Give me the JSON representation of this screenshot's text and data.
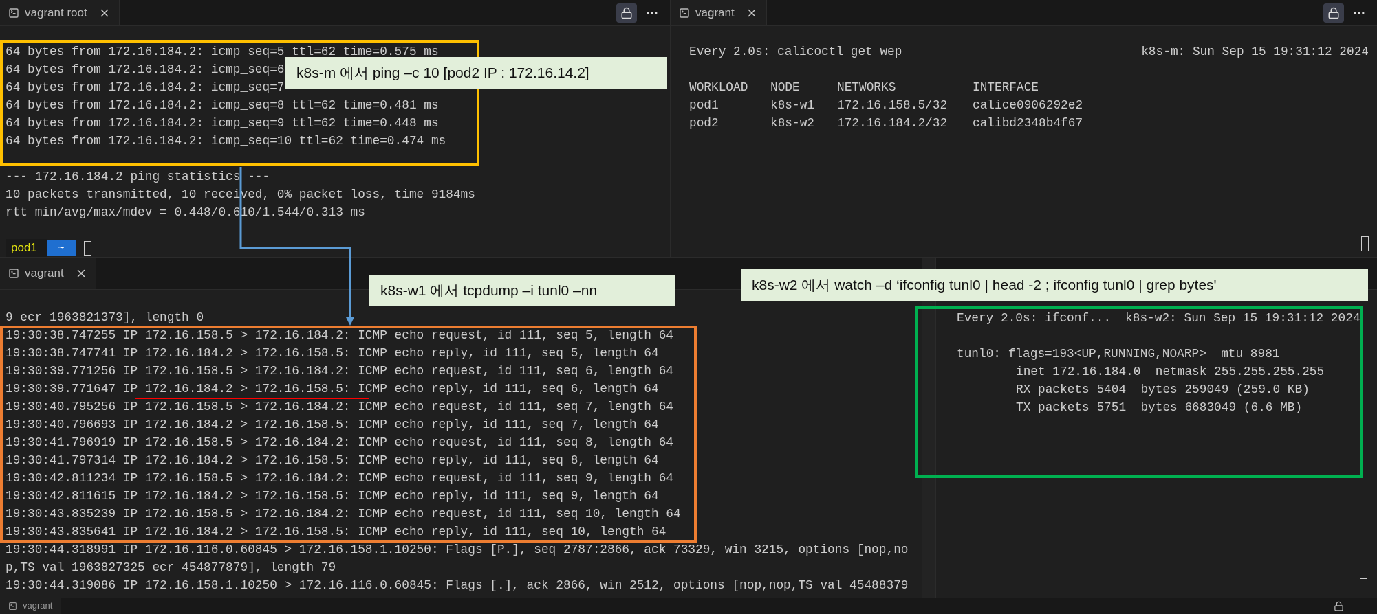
{
  "top_left_terminal": {
    "tab": {
      "label": "vagrant root"
    },
    "ping_replies": [
      "64 bytes from 172.16.184.2: icmp_seq=5 ttl=62 time=0.575 ms",
      "64 bytes from 172.16.184.2: icmp_seq=6",
      "64 bytes from 172.16.184.2: icmp_seq=7",
      "64 bytes from 172.16.184.2: icmp_seq=8 ttl=62 time=0.481 ms",
      "64 bytes from 172.16.184.2: icmp_seq=9 ttl=62 time=0.448 ms",
      "64 bytes from 172.16.184.2: icmp_seq=10 ttl=62 time=0.474 ms"
    ],
    "statistics": [
      "--- 172.16.184.2 ping statistics ---",
      "10 packets transmitted, 10 received, 0% packet loss, time 9184ms",
      "rtt min/avg/max/mdev = 0.448/0.610/1.544/0.313 ms"
    ],
    "prompt": {
      "user": "pod1",
      "path": "~"
    }
  },
  "top_right_terminal": {
    "tab": {
      "label": "vagrant"
    },
    "header": {
      "command": "Every 2.0s: calicoctl get wep",
      "status": "k8s-m: Sun Sep 15 19:31:12 2024"
    },
    "table": {
      "columns": [
        "WORKLOAD",
        "NODE",
        "NETWORKS",
        "INTERFACE"
      ],
      "rows": [
        [
          "pod1",
          "k8s-w1",
          "172.16.158.5/32",
          "calice0906292e2"
        ],
        [
          "pod2",
          "k8s-w2",
          "172.16.184.2/32",
          "calibd2348b4f67"
        ]
      ]
    }
  },
  "bottom_left_terminal": {
    "tab": {
      "label": "vagrant"
    },
    "lines": [
      "9 ecr 1963821373], length 0",
      "19:30:38.747255 IP 172.16.158.5 > 172.16.184.2: ICMP echo request, id 111, seq 5, length 64",
      "19:30:38.747741 IP 172.16.184.2 > 172.16.158.5: ICMP echo reply, id 111, seq 5, length 64",
      "19:30:39.771256 IP 172.16.158.5 > 172.16.184.2: ICMP echo request, id 111, seq 6, length 64",
      "19:30:39.771647 IP 172.16.184.2 > 172.16.158.5: ICMP echo reply, id 111, seq 6, length 64",
      "19:30:40.795256 IP 172.16.158.5 > 172.16.184.2: ICMP echo request, id 111, seq 7, length 64",
      "19:30:40.796693 IP 172.16.184.2 > 172.16.158.5: ICMP echo reply, id 111, seq 7, length 64",
      "19:30:41.796919 IP 172.16.158.5 > 172.16.184.2: ICMP echo request, id 111, seq 8, length 64",
      "19:30:41.797314 IP 172.16.184.2 > 172.16.158.5: ICMP echo reply, id 111, seq 8, length 64",
      "19:30:42.811234 IP 172.16.158.5 > 172.16.184.2: ICMP echo request, id 111, seq 9, length 64",
      "19:30:42.811615 IP 172.16.184.2 > 172.16.158.5: ICMP echo reply, id 111, seq 9, length 64",
      "19:30:43.835239 IP 172.16.158.5 > 172.16.184.2: ICMP echo request, id 111, seq 10, length 64",
      "19:30:43.835641 IP 172.16.184.2 > 172.16.158.5: ICMP echo reply, id 111, seq 10, length 64",
      "19:30:44.318991 IP 172.16.116.0.60845 > 172.16.158.1.10250: Flags [P.], seq 2787:2866, ack 73329, win 3215, options [nop,no",
      "p,TS val 1963827325 ecr 454877879], length 79",
      "19:30:44.319086 IP 172.16.158.1.10250 > 172.16.116.0.60845: Flags [.], ack 2866, win 2512, options [nop,nop,TS val 45488379"
    ]
  },
  "bottom_right_terminal": {
    "header": {
      "command": "Every 2.0s: ifconf...",
      "status": "k8s-w2: Sun Sep 15 19:31:12 2024"
    },
    "interface_line": "tunl0: flags=193<UP,RUNNING,NOARP>  mtu 8981",
    "detail_lines": [
      "inet 172.16.184.0  netmask 255.255.255.255",
      "RX packets 5404  bytes 259049 (259.0 KB)",
      "TX packets 5751  bytes 6683049 (6.6 MB)"
    ]
  },
  "bottom_tab": {
    "label": "vagrant"
  },
  "annotations": [
    {
      "text": "k8s-m 에서 ping –c 10 [pod2 IP : 172.16.14.2]"
    },
    {
      "text": "k8s-w1 에서 tcpdump –i tunl0 –nn"
    },
    {
      "text": "k8s-w2 에서 watch –d ‘ifconfig tunl0 | head -2 ; ifconfig tunl0 | grep bytes'"
    }
  ]
}
